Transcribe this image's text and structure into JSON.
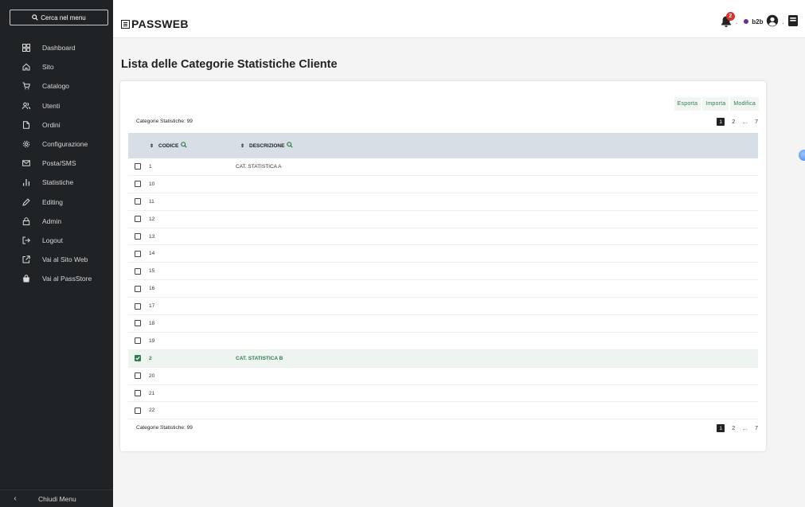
{
  "sidebar": {
    "search_label": "Cerca nel menu",
    "items": [
      {
        "label": "Dashboard",
        "icon": "dashboard-icon"
      },
      {
        "label": "Sito",
        "icon": "home-icon"
      },
      {
        "label": "Catalogo",
        "icon": "cart-icon"
      },
      {
        "label": "Utenti",
        "icon": "users-icon"
      },
      {
        "label": "Ordini",
        "icon": "document-icon"
      },
      {
        "label": "Configurazione",
        "icon": "gear-icon"
      },
      {
        "label": "Posta/SMS",
        "icon": "mail-icon"
      },
      {
        "label": "Statistiche",
        "icon": "bar-chart-icon"
      },
      {
        "label": "Editing",
        "icon": "pencil-icon"
      },
      {
        "label": "Admin",
        "icon": "lock-icon"
      },
      {
        "label": "Logout",
        "icon": "logout-icon"
      },
      {
        "label": "Vai al Sito Web",
        "icon": "external-link-icon"
      },
      {
        "label": "Vai al PassStore",
        "icon": "bag-icon"
      }
    ],
    "close_label": "Chiudi Menu"
  },
  "header": {
    "logo_text": "PASSWEB",
    "notification_count": "2",
    "separator": ".",
    "env_label": "b2b",
    "separator2": "."
  },
  "main": {
    "title": "Lista delle Categorie Statistiche Cliente",
    "toolbar": {
      "export": "Esporta",
      "import": "Importa",
      "edit": "Modifica"
    },
    "count_label": "Categorie Statistiche: 99",
    "pagination": {
      "current": "1",
      "next": "2",
      "ellipsis": "…",
      "last": "7"
    },
    "columns": {
      "code": "CODICE",
      "description": "DESCRIZIONE"
    },
    "sort_symbol": "⇕",
    "rows": [
      {
        "code": "1",
        "description": "CAT. STATISTICA A",
        "checked": false
      },
      {
        "code": "10",
        "description": "",
        "checked": false
      },
      {
        "code": "11",
        "description": "",
        "checked": false
      },
      {
        "code": "12",
        "description": "",
        "checked": false
      },
      {
        "code": "13",
        "description": "",
        "checked": false
      },
      {
        "code": "14",
        "description": "",
        "checked": false
      },
      {
        "code": "15",
        "description": "",
        "checked": false
      },
      {
        "code": "16",
        "description": "",
        "checked": false
      },
      {
        "code": "17",
        "description": "",
        "checked": false
      },
      {
        "code": "18",
        "description": "",
        "checked": false
      },
      {
        "code": "19",
        "description": "",
        "checked": false
      },
      {
        "code": "2",
        "description": "CAT. STATISTICA B",
        "checked": true
      },
      {
        "code": "20",
        "description": "",
        "checked": false
      },
      {
        "code": "21",
        "description": "",
        "checked": false
      },
      {
        "code": "22",
        "description": "",
        "checked": false
      }
    ]
  },
  "colors": {
    "sidebar_bg": "#1f2326",
    "accent_green": "#2e7d4f",
    "table_header_bg": "#d7dee5",
    "badge_red": "#d9342b",
    "env_dot": "#6b2e8f"
  }
}
